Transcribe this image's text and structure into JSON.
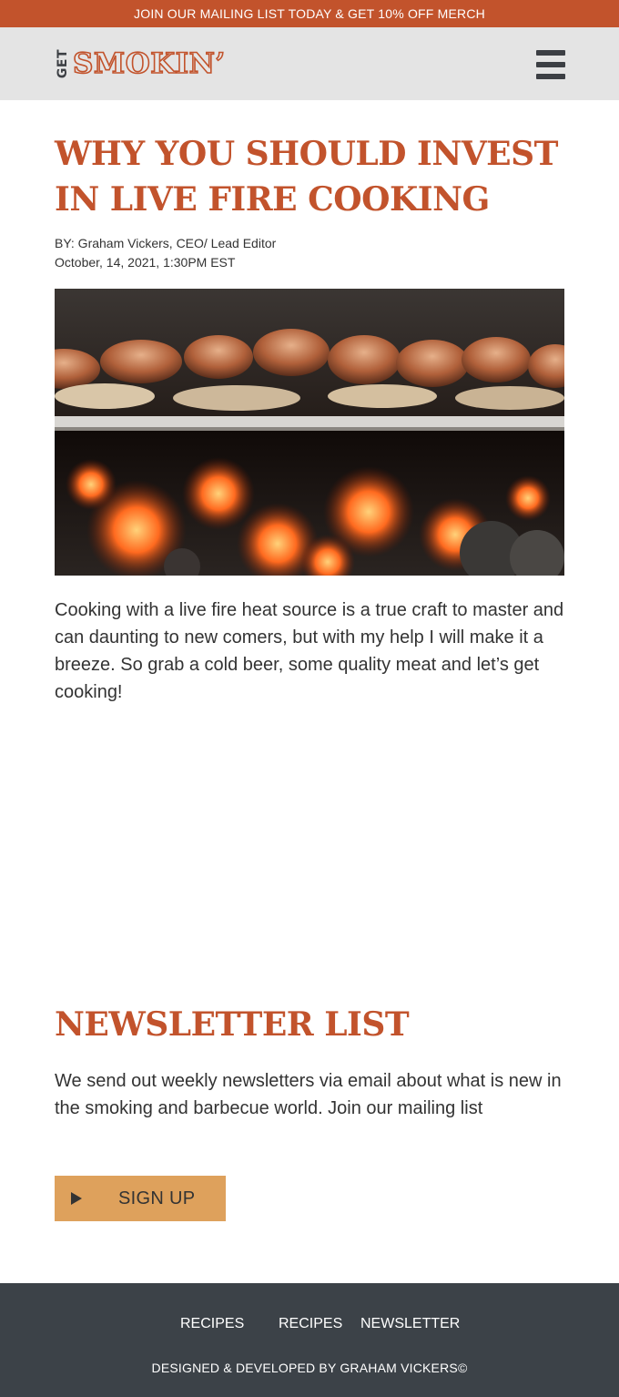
{
  "promo": {
    "text": "JOIN OUR MAILING LIST TODAY & GET 10% OFF MERCH"
  },
  "header": {
    "logo_prefix": "GET",
    "logo_name": "SMOKIN’",
    "menu_icon": "hamburger-menu-icon"
  },
  "article": {
    "title": "WHY YOU SHOULD INVEST IN LIVE FIRE COOKING",
    "byline": "BY: Graham Vickers, CEO/ Lead Editor",
    "date": "October, 14, 2021, 1:30PM EST",
    "image": "sausages grilling over live coals",
    "body": "Cooking with a live fire heat source is a true craft to master and can daunting to new comers, but with my help I will make it a breeze. So grab a cold beer, some quality meat and let’s get cooking!"
  },
  "newsletter": {
    "heading": "NEWSLETTER LIST",
    "text": "We send out weekly newsletters via email about what is new in the smoking and barbecue world. Join our mailing list",
    "button_label": "SIGN UP",
    "button_icon": "play-icon"
  },
  "footer": {
    "links": [
      "RECIPES",
      "RECIPES",
      "NEWSLETTER"
    ],
    "credit": "DESIGNED & DEVELOPED BY GRAHAM VICKERS©"
  },
  "colors": {
    "brand": "#c2532c",
    "header_bg": "#e4e4e4",
    "button": "#dea15c",
    "footer_bg": "#3c4248"
  }
}
